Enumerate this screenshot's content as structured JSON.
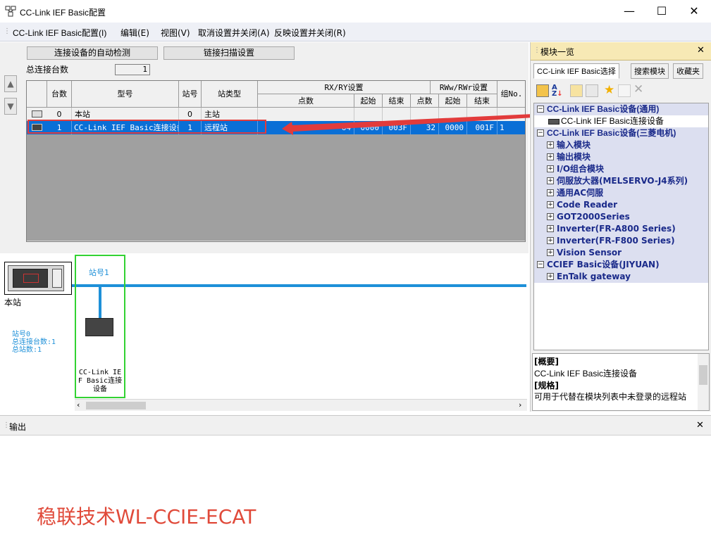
{
  "window": {
    "title": "CC-Link IEF Basic配置",
    "minimize": "—",
    "maximize": "☐",
    "close": "✕"
  },
  "menu": [
    "CC-Link IEF Basic配置(I)",
    "编辑(E)",
    "视图(V)",
    "取消设置并关闭(A)",
    "反映设置并关闭(R)"
  ],
  "toolbar": {
    "auto_detect": "连接设备的自动检测",
    "link_scan": "链接扫描设置",
    "total_devices_label": "总连接台数",
    "total_devices_value": "1"
  },
  "table": {
    "headers": {
      "count": "台数",
      "model": "型号",
      "station_no": "站号",
      "station_type": "站类型",
      "rxry": "RX/RY设置",
      "rwwrwr": "RWw/RWr设置",
      "group": "组No.",
      "points": "点数",
      "start": "起始",
      "end": "结束"
    },
    "rows": [
      {
        "count": "0",
        "model": "本站",
        "station": "0",
        "type": "主站",
        "rx_points": "",
        "rx_start": "",
        "rx_end": "",
        "rw_points": "",
        "rw_start": "",
        "rw_end": "",
        "group": ""
      },
      {
        "count": "1",
        "model": "CC-Link IEF Basic连接设备",
        "station": "1",
        "type": "远程站",
        "rx_points": "64",
        "rx_start": "0000",
        "rx_end": "003F",
        "rw_points": "32",
        "rw_start": "0000",
        "rw_end": "001F",
        "group": "1"
      }
    ]
  },
  "diagram": {
    "master_label": "本站",
    "station1_label": "站号1",
    "device_label": "CC-Link IE F Basic连接设备",
    "info_lines": [
      "站号0",
      "总连接台数:1",
      "总站数:1"
    ]
  },
  "module_list": {
    "title": "模块一览",
    "tabs": [
      "CC-Link IEF Basic选择",
      "搜索模块",
      "收藏夹"
    ],
    "tree": [
      {
        "label": "CC-Link IEF Basic设备(通用)",
        "level": 0,
        "toggle": "-"
      },
      {
        "label": "CC-Link IEF Basic连接设备",
        "level": 1,
        "toggle": ""
      },
      {
        "label": "CC-Link IEF Basic设备(三菱电机)",
        "level": 0,
        "toggle": "-"
      },
      {
        "label": "输入模块",
        "level": 1,
        "toggle": "+"
      },
      {
        "label": "输出模块",
        "level": 1,
        "toggle": "+"
      },
      {
        "label": "I/O组合模块",
        "level": 1,
        "toggle": "+"
      },
      {
        "label": "伺服放大器(MELSERVO-J4系列)",
        "level": 1,
        "toggle": "+"
      },
      {
        "label": "通用AC伺服",
        "level": 1,
        "toggle": "+"
      },
      {
        "label": "Code Reader",
        "level": 1,
        "toggle": "+"
      },
      {
        "label": "GOT2000Series",
        "level": 1,
        "toggle": "+"
      },
      {
        "label": "Inverter(FR-A800 Series)",
        "level": 1,
        "toggle": "+"
      },
      {
        "label": "Inverter(FR-F800 Series)",
        "level": 1,
        "toggle": "+"
      },
      {
        "label": "Vision Sensor",
        "level": 1,
        "toggle": "+"
      },
      {
        "label": "CCIEF Basic设备(JIYUAN)",
        "level": 0,
        "toggle": "-"
      },
      {
        "label": "EnTalk gateway",
        "level": 1,
        "toggle": "+"
      }
    ],
    "desc_overview_label": "[概要]",
    "desc_overview": "CC-Link IEF Basic连接设备",
    "desc_spec_label": "[规格]",
    "desc_spec": "可用于代替在模块列表中未登录的远程站"
  },
  "output": {
    "title": "输出",
    "watermark": "稳联技术WL-CCIE-ECAT"
  },
  "colors": {
    "accent": "#0a6fd6",
    "highlight": "#e23b3b",
    "network": "#1e90d8",
    "station_box": "#32d232"
  }
}
